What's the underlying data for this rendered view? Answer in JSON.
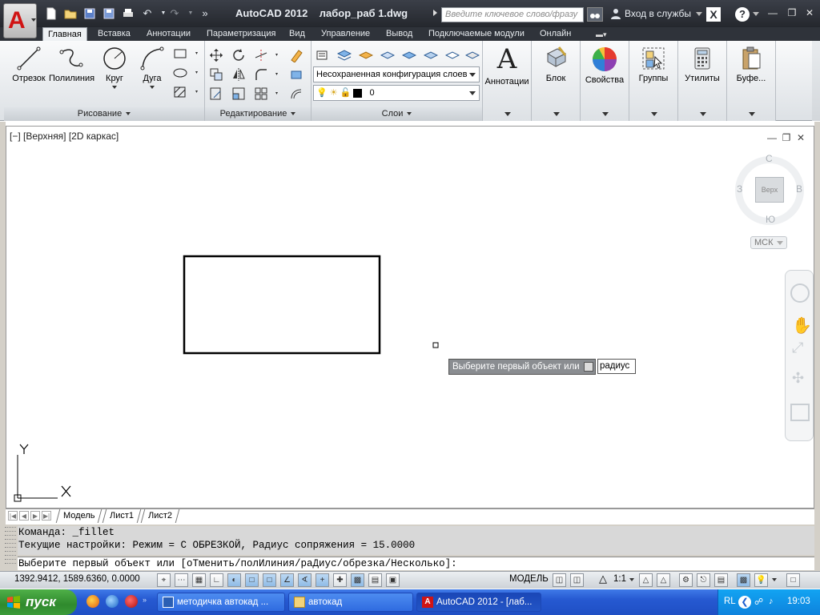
{
  "title_bar": {
    "app_title": "AutoCAD 2012",
    "file_name": "лабор_раб 1.dwg",
    "search_placeholder": "Введите ключевое слово/фразу",
    "login_label": "Вход в службы"
  },
  "ribbon_tabs": [
    "Главная",
    "Вставка",
    "Аннотации",
    "Параметризация",
    "Вид",
    "Управление",
    "Вывод",
    "Подключаемые модули",
    "Онлайн"
  ],
  "active_tab": "Главная",
  "panels": {
    "draw": {
      "title": "Рисование",
      "tools": [
        "Отрезок",
        "Полилиния",
        "Круг",
        "Дуга"
      ]
    },
    "modify": {
      "title": "Редактирование"
    },
    "layers": {
      "title": "Слои",
      "layer_state": "Несохраненная конфигурация слоев",
      "current_layer": "0"
    },
    "annotation": {
      "label": "Аннотации"
    },
    "block": {
      "label": "Блок"
    },
    "properties": {
      "label": "Свойства"
    },
    "groups": {
      "label": "Группы"
    },
    "utilities": {
      "label": "Утилиты"
    },
    "clipboard": {
      "label": "Буфе..."
    }
  },
  "viewport": {
    "label": "[−] [Верхняя] [2D каркас]",
    "viewcube": {
      "face": "Верх",
      "north": "С",
      "south": "Ю",
      "west": "З",
      "east": "В",
      "ucs_label": "МСК"
    },
    "ucs_axes": {
      "x": "X",
      "y": "Y"
    }
  },
  "dynamic_input": {
    "prompt": "Выберите первый объект или",
    "value": "радиус"
  },
  "layout_tabs": [
    "Модель",
    "Лист1",
    "Лист2"
  ],
  "active_layout": "Модель",
  "command_line": {
    "history": [
      "Команда: _fillet",
      "Текущие настройки: Режим = С ОБРЕЗКОЙ, Радиус сопряжения = 15.0000"
    ],
    "prompt": "Выберите первый объект или [оТменить/полИлиния/раДиус/обрезка/Несколько]:"
  },
  "status_bar": {
    "coordinates": "1392.9412, 1589.6360, 0.0000",
    "space": "МОДЕЛЬ",
    "annotation_scale": "1:1"
  },
  "taskbar": {
    "start_label": "пуск",
    "windows": [
      {
        "label": "методичка автокад ...",
        "active": false
      },
      {
        "label": "автокад",
        "active": false
      },
      {
        "label": "AutoCAD 2012 - [лаб...",
        "active": true
      }
    ],
    "lang": "RL",
    "clock": "19:03"
  },
  "colors": {
    "title_bar": "#2a2d33",
    "ribbon_bg": "#eef1f4",
    "autocad_red": "#d01414",
    "taskbar_blue": "#2659d1",
    "start_green": "#3b9b39"
  }
}
